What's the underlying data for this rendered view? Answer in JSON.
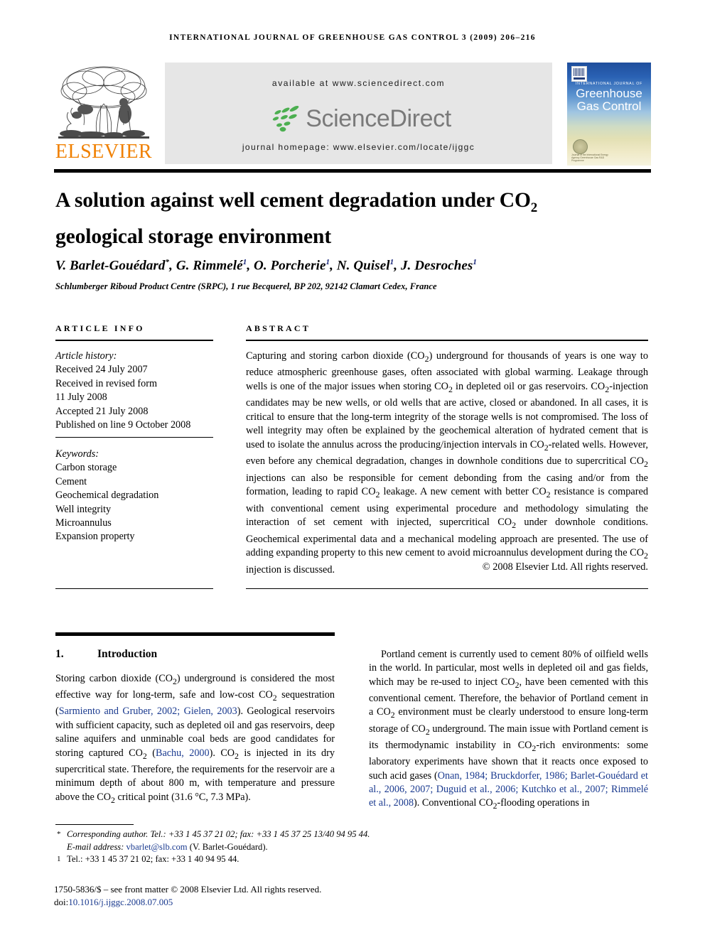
{
  "running_head": "International Journal of Greenhouse Gas Control 3 (2009) 206–216",
  "header": {
    "elsevier_wordmark": "ELSEVIER",
    "available_at": "available at www.sciencedirect.com",
    "sciencedirect_wordmark": "ScienceDirect",
    "journal_homepage": "journal homepage: www.elsevier.com/locate/ijggc",
    "cover": {
      "eyebrow": "International Journal of",
      "title": "Greenhouse Gas Control",
      "emblem_caption": "Journal of the International Energy Agency Greenhouse Gas R&D Programme"
    }
  },
  "article": {
    "title_line1": "A solution against well cement degradation under CO",
    "title_sub1": "2",
    "title_line2": "geological storage environment",
    "authors": [
      {
        "name": "V. Barlet-Gouédard",
        "mark": "*"
      },
      {
        "name": "G. Rimmelé",
        "mark": "1"
      },
      {
        "name": "O. Porcherie",
        "mark": "1"
      },
      {
        "name": "N. Quisel",
        "mark": "1"
      },
      {
        "name": "J. Desroches",
        "mark": "1"
      }
    ],
    "affiliation": "Schlumberger Riboud Product Centre (SRPC), 1 rue Becquerel, BP 202, 92142 Clamart Cedex, France"
  },
  "article_info": {
    "heading": "ARTICLE INFO",
    "history_label": "Article history:",
    "history": [
      "Received 24 July 2007",
      "Received in revised form",
      "11 July 2008",
      "Accepted 21 July 2008",
      "Published on line 9 October 2008"
    ],
    "keywords_label": "Keywords:",
    "keywords": [
      "Carbon storage",
      "Cement",
      "Geochemical degradation",
      "Well integrity",
      "Microannulus",
      "Expansion property"
    ]
  },
  "abstract": {
    "heading": "ABSTRACT",
    "text": "Capturing and storing carbon dioxide (CO2) underground for thousands of years is one way to reduce atmospheric greenhouse gases, often associated with global warming. Leakage through wells is one of the major issues when storing CO2 in depleted oil or gas reservoirs. CO2-injection candidates may be new wells, or old wells that are active, closed or abandoned. In all cases, it is critical to ensure that the long-term integrity of the storage wells is not compromised. The loss of well integrity may often be explained by the geochemical alteration of hydrated cement that is used to isolate the annulus across the producing/injection intervals in CO2-related wells. However, even before any chemical degradation, changes in downhole conditions due to supercritical CO2 injections can also be responsible for cement debonding from the casing and/or from the formation, leading to rapid CO2 leakage. A new cement with better CO2 resistance is compared with conventional cement using experimental procedure and methodology simulating the interaction of set cement with injected, supercritical CO2 under downhole conditions. Geochemical experimental data and a mechanical modeling approach are presented. The use of adding expanding property to this new cement to avoid microannulus development during the CO2 injection is discussed.",
    "copyright": "© 2008 Elsevier Ltd. All rights reserved."
  },
  "introduction": {
    "number": "1.",
    "title": "Introduction",
    "left_text": "Storing carbon dioxide (CO2) underground is considered the most effective way for long-term, safe and low-cost CO2 sequestration (Sarmiento and Gruber, 2002; Gielen, 2003). Geological reservoirs with sufficient capacity, such as depleted oil and gas reservoirs, deep saline aquifers and unminable coal beds are good candidates for storing captured CO2 (Bachu, 2000). CO2 is injected in its dry supercritical state. Therefore, the requirements for the reservoir are a minimum depth of about 800 m, with temperature and pressure above the CO2 critical point (31.6 °C, 7.3 MPa).",
    "right_text": "Portland cement is currently used to cement 80% of oilfield wells in the world. In particular, most wells in depleted oil and gas fields, which may be re-used to inject CO2, have been cemented with this conventional cement. Therefore, the behavior of Portland cement in a CO2 environment must be clearly understood to ensure long-term storage of CO2 underground. The main issue with Portland cement is its thermodynamic instability in CO2-rich environments: some laboratory experiments have shown that it reacts once exposed to such acid gases (Onan, 1984; Bruckdorfer, 1986; Barlet-Gouédard et al., 2006, 2007; Duguid et al., 2006; Kutchko et al., 2007; Rimmelé et al., 2008). Conventional CO2-flooding operations in"
  },
  "footnotes": {
    "corresponding_mark": "*",
    "corresponding": "Corresponding author. Tel.: +33 1 45 37 21 02; fax: +33 1 45 37 25 13/40 94 95 44.",
    "email_label": "E-mail address:",
    "email": "vbarlet@slb.com",
    "email_suffix": "(V. Barlet-Gouédard).",
    "tel_mark": "1",
    "tel": "Tel.: +33 1 45 37 21 02; fax: +33 1 40 94 95 44.",
    "front_matter": "1750-5836/$ – see front matter © 2008 Elsevier Ltd. All rights reserved.",
    "doi_label": "doi:",
    "doi": "10.1016/j.ijggc.2008.07.005"
  },
  "colors": {
    "elsevier_orange": "#F08000",
    "sciencedirect_green": "#4CAF50",
    "sciencedirect_gray": "#7A7A7A",
    "citation_blue": "#1A3A8F",
    "cover_blue": "#1F4E9C"
  }
}
